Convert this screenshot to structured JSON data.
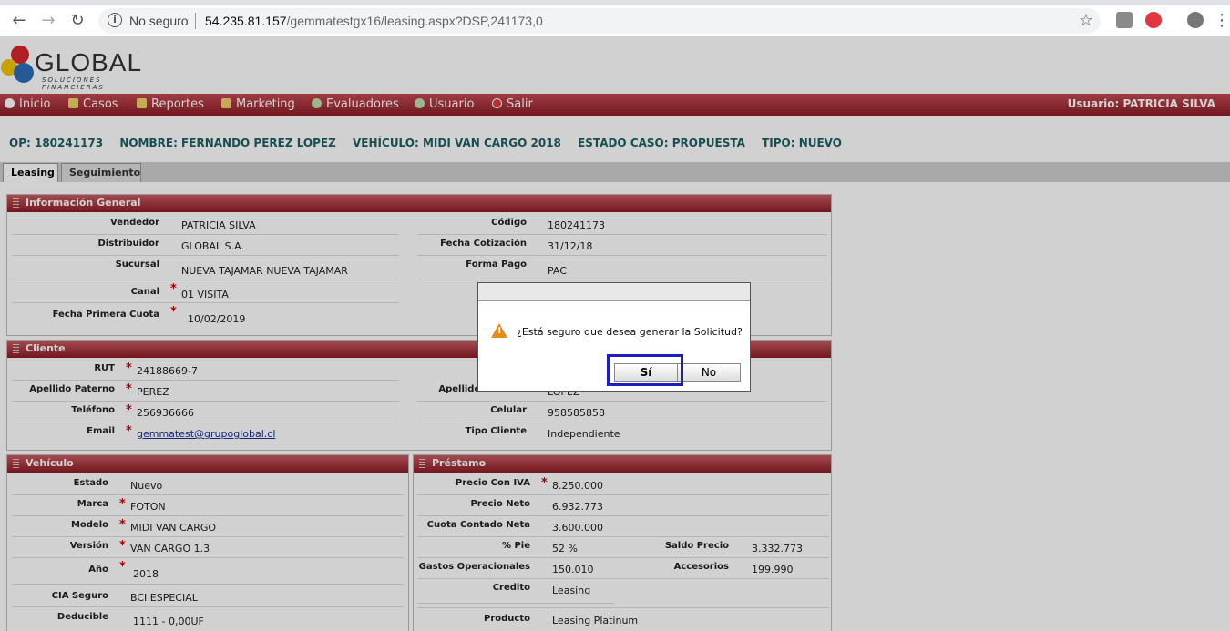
{
  "browser": {
    "security": "No seguro",
    "url_host": "54.235.81.157",
    "url_path": "/gemmatestgx16/leasing.aspx?DSP,241173,0"
  },
  "app": {
    "logo": "GLOBAL",
    "logo_sub": "SOLUCIONES FINANCIERAS",
    "menu": [
      "Inicio",
      "Casos",
      "Reportes",
      "Marketing",
      "Evaluadores",
      "Usuario",
      "Salir"
    ],
    "user": "Usuario:  PATRICIA SILVA"
  },
  "summary": {
    "op": "OP: 180241173",
    "nombre": "NOMBRE: FERNANDO PEREZ LOPEZ",
    "vehiculo": "VEHÍCULO: MIDI VAN CARGO 2018",
    "estado": "ESTADO CASO: PROPUESTA",
    "tipo": "TIPO: NUEVO"
  },
  "tabs": [
    "Leasing",
    "Seguimiento"
  ],
  "info": {
    "title": "Información General",
    "vendedor_l": "Vendedor",
    "vendedor": "PATRICIA SILVA",
    "codigo_l": "Código",
    "codigo": "180241173",
    "distribuidor_l": "Distribuidor",
    "distribuidor": "GLOBAL S.A.",
    "fecha_cot_l": "Fecha Cotización",
    "fecha_cot": "31/12/18",
    "sucursal_l": "Sucursal",
    "sucursal": "NUEVA TAJAMAR  NUEVA TAJAMAR",
    "forma_pago_l": "Forma Pago",
    "forma_pago": "PAC",
    "canal_l": "Canal",
    "canal": "01 VISITA",
    "fecha_primera_l": "Fecha Primera Cuota",
    "fecha_primera": "10/02/2019"
  },
  "cliente": {
    "title": "Cliente",
    "rut_l": "RUT",
    "rut": "24188669-7",
    "ap_pat_l": "Apellido Paterno",
    "ap_pat": "PEREZ",
    "ap_mat_l": "Apellido Materno",
    "ap_mat": "LOPEZ",
    "tel_l": "Teléfono",
    "tel": "256936666",
    "cel_l": "Celular",
    "cel": "958585858",
    "email_l": "Email",
    "email": "gemmatest@grupoglobal.cl",
    "tipo_l": "Tipo Cliente",
    "tipo": "Independiente"
  },
  "vehiculo": {
    "title": "Vehículo",
    "estado_l": "Estado",
    "estado": "Nuevo",
    "marca_l": "Marca",
    "marca": "FOTON",
    "modelo_l": "Modelo",
    "modelo": "MIDI VAN CARGO",
    "version_l": "Versión",
    "version": "VAN CARGO 1.3",
    "anio_l": "Año",
    "anio": "2018",
    "cia_l": "CIA Seguro",
    "cia": "BCI ESPECIAL",
    "deducible_l": "Deducible",
    "deducible": "1111  -   0,00UF"
  },
  "prestamo": {
    "title": "Préstamo",
    "precio_iva_l": "Precio Con IVA",
    "precio_iva": "8.250.000",
    "precio_neto_l": "Precio Neto",
    "precio_neto": "6.932.773",
    "cuota_l": "Cuota Contado Neta",
    "cuota": "3.600.000",
    "pie_l": "% Pie",
    "pie": "52 %",
    "saldo_l": "Saldo Precio",
    "saldo": "3.332.773",
    "gastos_l": "Gastos Operacionales",
    "gastos": "150.010",
    "acces_l": "Accesorios",
    "acces": "199.990",
    "credito_l": "Credito",
    "credito": "Leasing",
    "producto_l": "Producto",
    "producto": "Leasing Platinum"
  },
  "dialog": {
    "message": "¿Está seguro que desea generar la Solicitud?",
    "yes": "Sí",
    "no": "No"
  }
}
